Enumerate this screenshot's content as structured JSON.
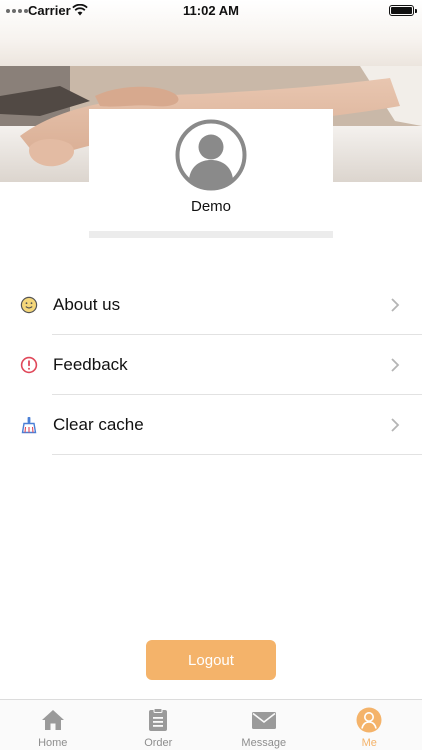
{
  "status_bar": {
    "carrier": "Carrier",
    "time": "11:02 AM"
  },
  "profile": {
    "username": "Demo"
  },
  "menu": {
    "items": [
      {
        "label": "About us",
        "icon": "smiley-icon"
      },
      {
        "label": "Feedback",
        "icon": "alert-circle-icon"
      },
      {
        "label": "Clear cache",
        "icon": "broom-icon"
      }
    ]
  },
  "logout_label": "Logout",
  "tabbar": {
    "tabs": [
      {
        "label": "Home",
        "icon": "home-icon",
        "active": false
      },
      {
        "label": "Order",
        "icon": "clipboard-icon",
        "active": false
      },
      {
        "label": "Message",
        "icon": "envelope-icon",
        "active": false
      },
      {
        "label": "Me",
        "icon": "user-icon",
        "active": true
      }
    ]
  },
  "colors": {
    "accent": "#f4b36a",
    "tab_inactive": "#8e8e8e",
    "feedback_icon": "#e0485a",
    "clear_cache_icon": "#4a7fd6"
  }
}
